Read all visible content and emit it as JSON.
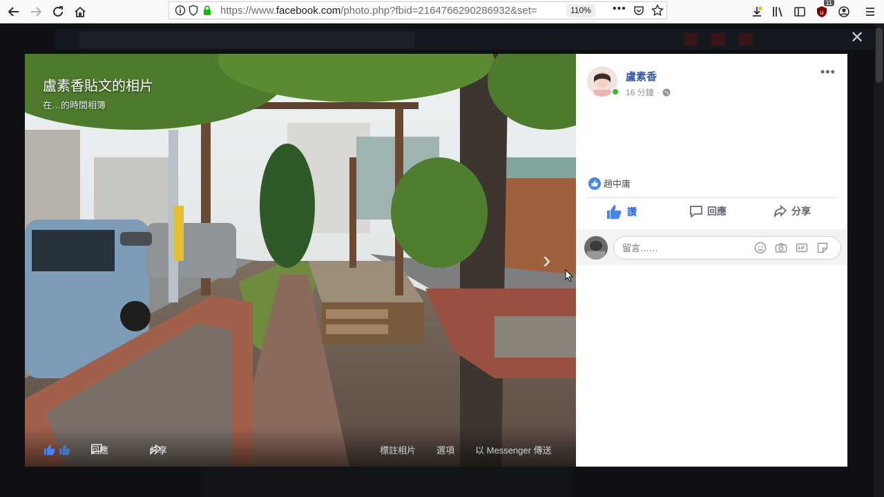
{
  "browser": {
    "url_prefix": "https://www.",
    "url_domain": "facebook.com",
    "url_path": "/photo.php?fbid=2164766290286932&set=",
    "zoom": "110%",
    "extension_badge": "11"
  },
  "photo": {
    "title": "盧素香貼文的相片",
    "subtitle": "在…的時間相簿",
    "actions": {
      "comment": "回應",
      "share": "分享",
      "tag": "標註相片",
      "options": "選項",
      "messenger": "以 Messenger 傳送"
    }
  },
  "post": {
    "author": "盧素香",
    "time": "16 分鐘",
    "liker": "趙中庸",
    "like_label": "讚",
    "comment_label": "回應",
    "share_label": "分享",
    "comment_placeholder": "留言……"
  },
  "colors": {
    "facebook_blue": "#385898",
    "like_blue": "#2d6ae3",
    "online_green": "#42b72a"
  }
}
